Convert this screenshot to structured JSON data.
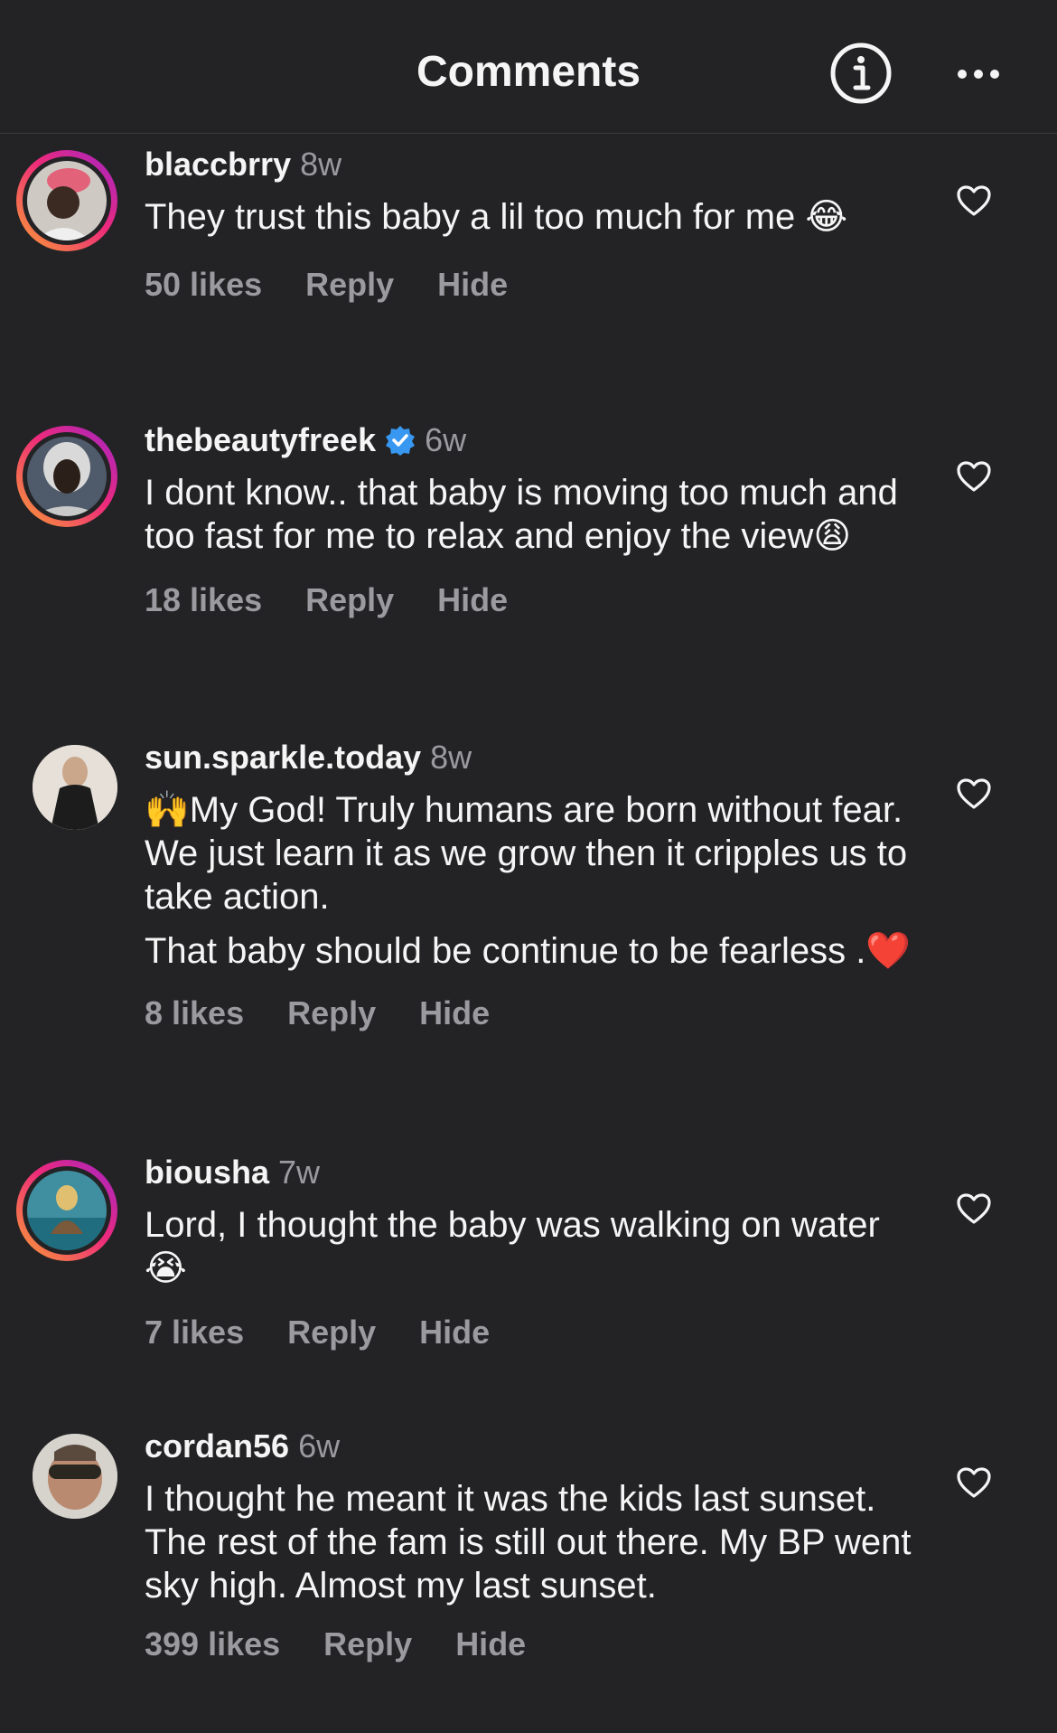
{
  "header": {
    "title": "Comments",
    "info_icon": "info-circle-icon",
    "more_icon": "ellipsis-icon"
  },
  "colors": {
    "background": "#232325",
    "text": "#f5f5f5",
    "muted": "#9a9a9f",
    "verified": "#3897f0",
    "story_ring": [
      "#f9a033",
      "#ee2a7b",
      "#a024c9"
    ]
  },
  "comments": [
    {
      "username": "blaccbrry",
      "time": "8w",
      "verified": false,
      "paragraphs": [
        "They trust this baby a lil too much for me 😂"
      ],
      "likes": "50 likes",
      "reply": "Reply",
      "hide": "Hide"
    },
    {
      "username": "thebeautyfreek",
      "time": "6w",
      "verified": true,
      "paragraphs": [
        "I dont know.. that baby is moving too much and too fast for me to relax and enjoy the view😩"
      ],
      "likes": "18 likes",
      "reply": "Reply",
      "hide": "Hide"
    },
    {
      "username": "sun.sparkle.today",
      "time": "8w",
      "verified": false,
      "paragraphs": [
        "🙌My God! Truly humans are born without fear. We just learn it as we grow then it cripples us to take action.",
        "That baby should be continue to be fearless .❤️"
      ],
      "likes": "8 likes",
      "reply": "Reply",
      "hide": "Hide"
    },
    {
      "username": "biousha",
      "time": "7w",
      "verified": false,
      "paragraphs": [
        "Lord, I thought the baby was walking on water 😭"
      ],
      "likes": "7 likes",
      "reply": "Reply",
      "hide": "Hide"
    },
    {
      "username": "cordan56",
      "time": "6w",
      "verified": false,
      "paragraphs": [
        "I thought he meant it was the kids last sunset. The rest of the fam is still out there. My BP went sky high. Almost my last sunset."
      ],
      "likes": "399 likes",
      "reply": "Reply",
      "hide": "Hide"
    }
  ]
}
